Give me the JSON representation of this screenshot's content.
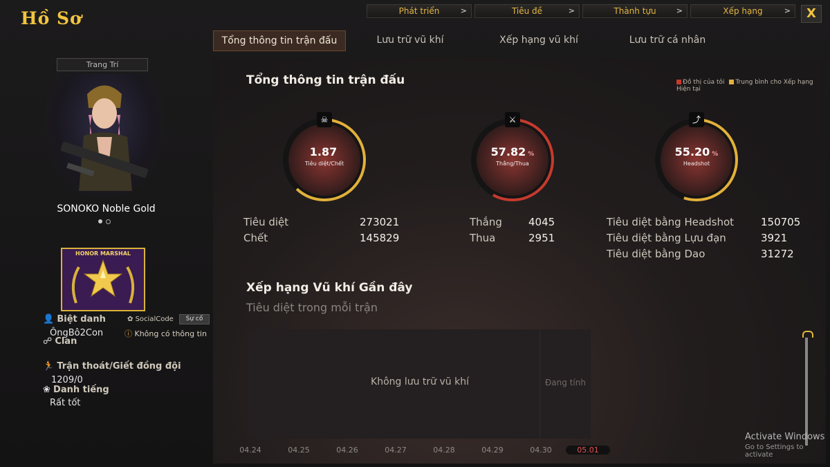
{
  "window": {
    "title": "Hồ Sơ",
    "close_label": "X"
  },
  "topnav": [
    {
      "label": "Phát triển"
    },
    {
      "label": "Tiêu đề"
    },
    {
      "label": "Thành tựu"
    },
    {
      "label": "Xếp hạng"
    }
  ],
  "tabs": [
    {
      "label": "Tổng thông tin trận đấu",
      "active": true
    },
    {
      "label": "Lưu trữ vũ khí",
      "active": false
    },
    {
      "label": "Xếp hạng vũ khí",
      "active": false
    },
    {
      "label": "Lưu trữ cá nhân",
      "active": false
    }
  ],
  "profile": {
    "trangtri_label": "Trang Trí",
    "character_name": "SONOKO Noble Gold",
    "badge_title": "HONOR MARSHAL",
    "nickname_label": "Biệt danh",
    "nickname_value": "ÔngBô2Con",
    "socialcode_label": "SocialCode",
    "suco_button": "Sự cố",
    "no_info": "Không có thông tin",
    "clan_label": "Clan",
    "escape_label": "Trận thoát/Giết đồng đội",
    "escape_value": "1209/0",
    "reputation_label": "Danh tiếng",
    "reputation_value": "Rất tốt"
  },
  "summary": {
    "title": "Tổng thông tin trận đấu",
    "legend_mine": "Đồ thị của tôi",
    "legend_avg": "Trung bình cho Xếp hạng Hiện tại",
    "gauges": [
      {
        "value": "1.87",
        "unit": "",
        "label": "Tiêu diệt/Chết",
        "icon": "skull-icon",
        "fill": 0.62
      },
      {
        "value": "57.82",
        "unit": "%",
        "label": "Thắng/Thua",
        "icon": "crossed-guns-icon",
        "fill": 0.58
      },
      {
        "value": "55.20",
        "unit": "%",
        "label": "Headshot",
        "icon": "rifle-icon",
        "fill": 0.55
      }
    ],
    "stats_col1": [
      {
        "label": "Tiêu diệt",
        "value": "273021"
      },
      {
        "label": "Chết",
        "value": "145829"
      }
    ],
    "stats_col2": [
      {
        "label": "Thắng",
        "value": "4045"
      },
      {
        "label": "Thua",
        "value": "2951"
      }
    ],
    "stats_col3": [
      {
        "label": "Tiêu diệt bằng Headshot",
        "value": "150705"
      },
      {
        "label": "Tiêu diệt bằng Lựu đạn",
        "value": "3921"
      },
      {
        "label": "Tiêu diệt bằng Dao",
        "value": "31272"
      }
    ]
  },
  "weapon_ranking": {
    "title": "Xếp hạng Vũ khí Gần đây",
    "subtitle": "Tiêu diệt trong mỗi trận",
    "empty_text": "Không lưu trữ vũ khí",
    "pending_text": "Đang tính",
    "dates": [
      "04.24",
      "04.25",
      "04.26",
      "04.27",
      "04.28",
      "04.29",
      "04.30",
      "05.01"
    ],
    "selected_date": "05.01"
  },
  "watermark": {
    "line1": "Activate Windows",
    "line2": "Go to Settings to activate"
  },
  "colors": {
    "accent": "#f2c53f",
    "gauge_red": "#c63a2e",
    "gauge_yellow": "#e2b13a"
  }
}
